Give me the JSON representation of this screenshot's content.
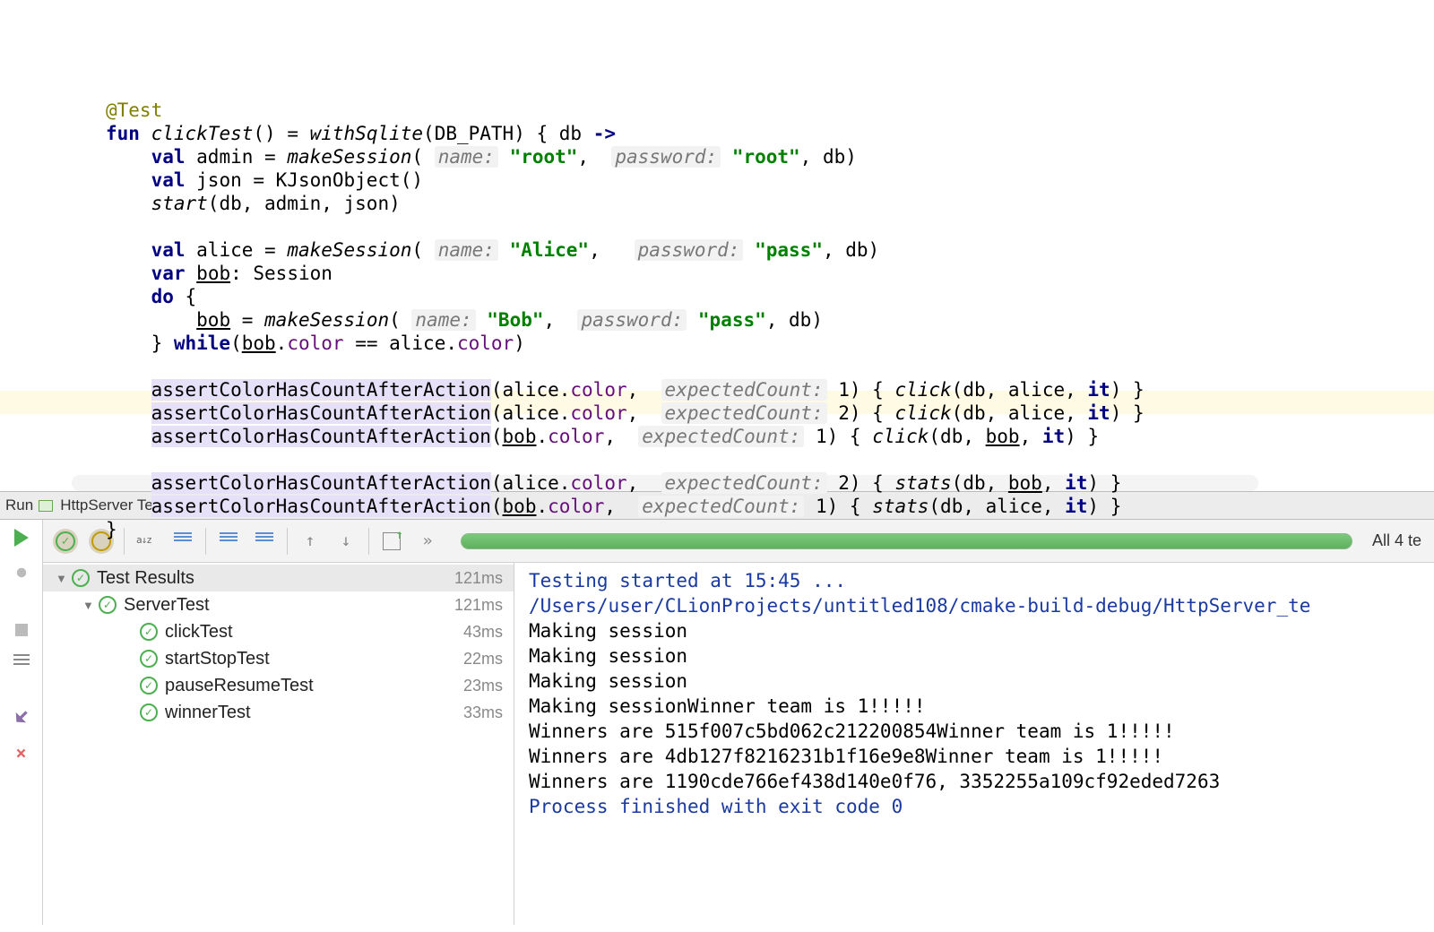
{
  "code": {
    "ann": "@Test",
    "l2_fun": "fun",
    "l2_name": "clickTest",
    "l2_after": "() = ",
    "l2_with": "withSqlite",
    "l2_arg": "(DB_PATH) { db ",
    "l2_arrow": "->",
    "l3": "    ",
    "l3_val": "val",
    "l3_admin": " admin = ",
    "l3_ms": "makeSession",
    "l3_open": "( ",
    "l3_p1": "name:",
    "l3_s1": "\"root\"",
    "l3_mid": ",  ",
    "l3_p2": "password:",
    "l3_s2": "\"root\"",
    "l3_end": ", db)",
    "l4_val": "val",
    "l4_rest": " json = KJsonObject()",
    "l5": "    ",
    "l5_fn": "start",
    "l5_rest": "(db, admin, json)",
    "l7_val": "val",
    "l7_a": " alice = ",
    "l7_ms": "makeSession",
    "l7_open": "( ",
    "l7_p1": "name:",
    "l7_s1": "\"Alice\"",
    "l7_mid": ",   ",
    "l7_p2": "password:",
    "l7_s2": "\"pass\"",
    "l7_end": ", db)",
    "l8_var": "var",
    "l8_b": " ",
    "l8_bob": "bob",
    "l8_rest": ": Session",
    "l9_do": "do",
    "l9_b": " {",
    "l10_sp": "        ",
    "l10_bob": "bob",
    "l10_eq": " = ",
    "l10_ms": "makeSession",
    "l10_open": "( ",
    "l10_p1": "name:",
    "l10_s1": "\"Bob\"",
    "l10_mid": ",  ",
    "l10_p2": "password:",
    "l10_s2": "\"pass\"",
    "l10_end": ", db)",
    "l11_a": "    } ",
    "l11_while": "while",
    "l11_b": "(",
    "l11_bob": "bob",
    "l11_c": ".",
    "l11_color1": "color",
    "l11_d": " == alice.",
    "l11_color2": "color",
    "l11_e": ")",
    "ass": "assertColorHasCountAfterAction",
    "al_color": "color",
    "dot": ".",
    "al_open": "(alice",
    "bob_open": "(",
    "bob_u": "bob",
    "p_exp": "expectedCount:",
    "v1": "1",
    "v2": "2",
    "lam_o": ") { ",
    "click": "click",
    "stats": "stats",
    "c_al": "(db, alice, ",
    "c_bo": "(db, ",
    "it": "it",
    "lam_c": ") }",
    "close": "}",
    "comma": ",  "
  },
  "toolHeader": {
    "run": "Run",
    "name": "HttpServer Test"
  },
  "toolbar": {
    "more": "»",
    "status": "All 4 te"
  },
  "tree": {
    "root": {
      "name": "Test Results",
      "time": "121ms"
    },
    "cls": {
      "name": "ServerTest",
      "time": "121ms"
    },
    "tests": [
      {
        "name": "clickTest",
        "time": "43ms"
      },
      {
        "name": "startStopTest",
        "time": "22ms"
      },
      {
        "name": "pauseResumeTest",
        "time": "23ms"
      },
      {
        "name": "winnerTest",
        "time": "33ms"
      }
    ]
  },
  "console": {
    "l1": "Testing started at 15:45 ...",
    "l2": "/Users/user/CLionProjects/untitled108/cmake-build-debug/HttpServer_te",
    "l3": "Making session",
    "l4": "Making session",
    "l5": "Making session",
    "l6": "Making sessionWinner team is 1!!!!!",
    "l7": "Winners are 515f007c5bd062c212200854Winner team is 1!!!!!",
    "l8": "Winners are 4db127f8216231b1f16e9e8Winner team is 1!!!!!",
    "l9": "Winners are 1190cde766ef438d140e0f76, 3352255a109cf92eded7263",
    "l10": "Process finished with exit code 0"
  }
}
